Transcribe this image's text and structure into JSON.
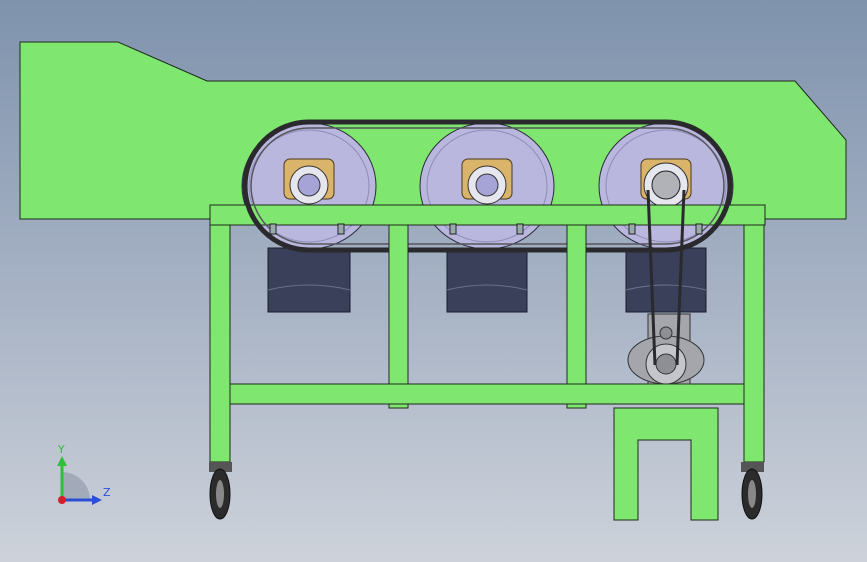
{
  "triad": {
    "y_label": "Y",
    "z_label": "Z",
    "y_color": "#2fbf3a",
    "z_color": "#2a4fd6",
    "origin_color": "#d0202a"
  },
  "colors": {
    "frame_green": "#7fe66f",
    "edge": "#1d2a1a",
    "roller_face": "#b9b7dd",
    "bearing": "#d9b46a",
    "hopper": "#3a3f5a",
    "belt": "#2a2a2e",
    "motor": "#a4a6ab",
    "wheel": "#2b2b2b"
  },
  "components": {
    "rollers": 3,
    "hoppers": 3,
    "caster_wheels": 2,
    "motor": 1
  }
}
